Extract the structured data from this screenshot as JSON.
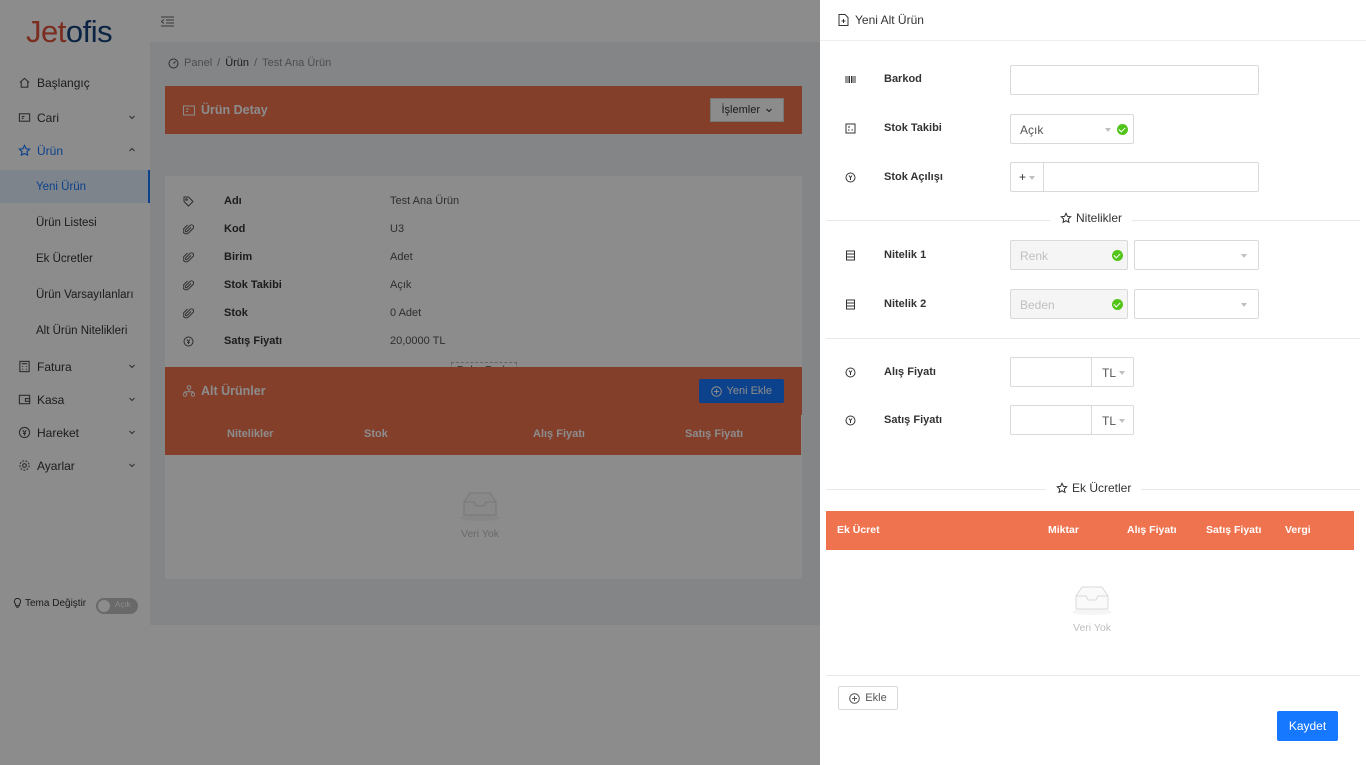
{
  "brand": {
    "logo_part1": "Jet",
    "logo_part2": "ofis"
  },
  "sidebar": {
    "items": [
      {
        "label": "Başlangıç",
        "icon": "home-icon"
      },
      {
        "label": "Cari",
        "icon": "idcard-icon"
      },
      {
        "label": "Ürün",
        "icon": "star-icon"
      },
      {
        "label": "Fatura",
        "icon": "calculator-icon"
      },
      {
        "label": "Kasa",
        "icon": "wallet-icon"
      },
      {
        "label": "Hareket",
        "icon": "currency-icon"
      },
      {
        "label": "Ayarlar",
        "icon": "gear-icon"
      }
    ],
    "sub_items": [
      "Yeni Ürün",
      "Ürün Listesi",
      "Ek Ücretler",
      "Ürün Varsayılanları",
      "Alt Ürün Nitelikleri"
    ],
    "theme_label": "Tema Değiştir",
    "theme_toggle": "Açık"
  },
  "breadcrumb": {
    "panel": "Panel",
    "sep": "/",
    "urun": "Ürün",
    "current": "Test Ana Ürün"
  },
  "detail_card": {
    "title": "Ürün Detay",
    "actions_label": "İşlemler",
    "rows": [
      {
        "label": "Adı",
        "value": "Test Ana Ürün"
      },
      {
        "label": "Kod",
        "value": "U3"
      },
      {
        "label": "Birim",
        "value": "Adet"
      },
      {
        "label": "Stok Takibi",
        "value": "Açık"
      },
      {
        "label": "Stok",
        "value": "0 Adet"
      },
      {
        "label": "Satış Fiyatı",
        "value": "20,0000 TL"
      }
    ],
    "more_label": "Daha Fazla"
  },
  "sub_products_card": {
    "title": "Alt Ürünler",
    "add_label": "Yeni Ekle",
    "columns": [
      "Nitelikler",
      "Stok",
      "Alış Fiyatı",
      "Satış Fiyatı"
    ],
    "empty_text": "Veri Yok"
  },
  "drawer": {
    "title": "Yeni Alt Ürün",
    "barkod_label": "Barkod",
    "barkod_value": "",
    "stok_takibi_label": "Stok Takibi",
    "stok_takibi_value": "Açık",
    "stok_acilisi_label": "Stok Açılışı",
    "stok_acilisi_sign": "+",
    "stok_acilisi_value": "",
    "nitelikler_title": "Nitelikler",
    "nitelik1_label": "Nitelik 1",
    "nitelik1_value": "Renk",
    "nitelik2_label": "Nitelik 2",
    "nitelik2_value": "Beden",
    "alis_label": "Alış Fiyatı",
    "alis_currency": "TL",
    "satis_label": "Satış Fiyatı",
    "satis_currency": "TL",
    "ek_title": "Ek Ücretler",
    "ek_columns": [
      "Ek Ücret",
      "Miktar",
      "Alış Fiyatı",
      "Satış Fiyatı",
      "Vergi"
    ],
    "ek_empty": "Veri Yok",
    "ekle_label": "Ekle",
    "save_label": "Kaydet"
  }
}
